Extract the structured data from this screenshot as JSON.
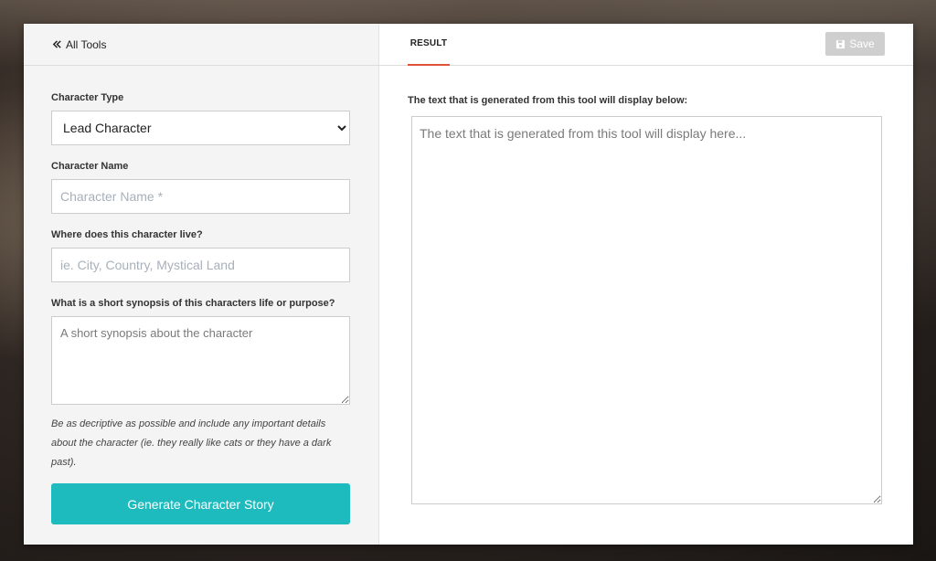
{
  "nav": {
    "back_label": "All Tools"
  },
  "form": {
    "character_type": {
      "label": "Character Type",
      "selected": "Lead Character",
      "options": [
        "Lead Character"
      ]
    },
    "character_name": {
      "label": "Character Name",
      "placeholder": "Character Name *",
      "value": ""
    },
    "character_home": {
      "label": "Where does this character live?",
      "placeholder": "ie. City, Country, Mystical Land",
      "value": ""
    },
    "synopsis": {
      "label": "What is a short synopsis of this characters life or purpose?",
      "placeholder": "A short synopsis about the character",
      "value": ""
    },
    "hint": "Be as decriptive as possible and include any important details about the character (ie. they really like cats or they have a dark past).",
    "generate_label": "Generate Character Story"
  },
  "result": {
    "tab_label": "RESULT",
    "save_label": "Save",
    "intro": "The text that is generated from this tool will display below:",
    "placeholder": "The text that is generated from this tool will display here..."
  },
  "colors": {
    "accent": "#1dbbbd",
    "tab_underline": "#e0533a",
    "save_disabled": "#cfcfcf"
  }
}
